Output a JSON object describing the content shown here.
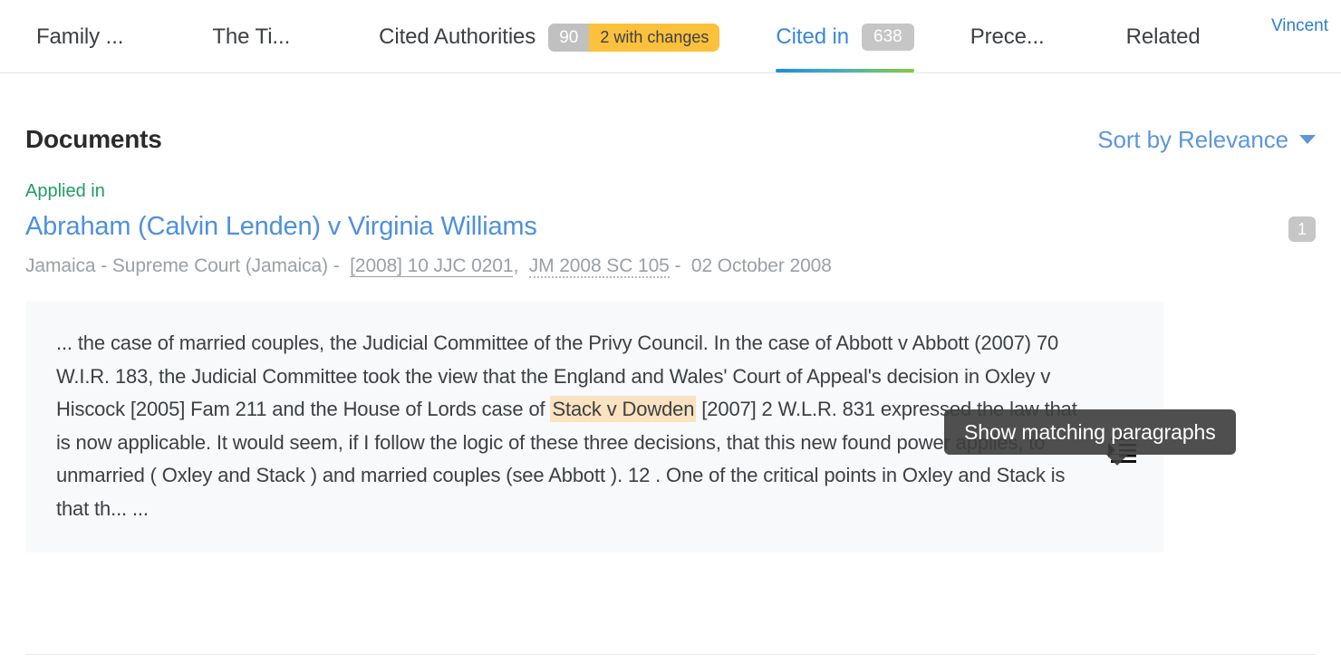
{
  "tabs": [
    {
      "label": "Family ...",
      "active": false,
      "badge": null
    },
    {
      "label": "The Ti...",
      "active": false,
      "badge": null
    },
    {
      "label": "Cited Authorities",
      "active": false,
      "badge_split": {
        "count": "90",
        "changes": "2 with changes"
      }
    },
    {
      "label": "Cited in",
      "active": true,
      "badge": "638"
    },
    {
      "label": "Prece...",
      "active": false,
      "badge": null
    },
    {
      "label": "Related",
      "active": false,
      "badge": null
    }
  ],
  "brand_mark": "Vincent",
  "header": {
    "title": "Documents",
    "sort_label": "Sort by Relevance",
    "sort_icon": "chevron-down-icon"
  },
  "result": {
    "relation": "Applied in",
    "case_title": "Abraham (Calvin Lenden) v Virginia Williams",
    "count_chip": "1",
    "meta": {
      "jurisdiction": "Jamaica - Supreme Court (Jamaica)",
      "dash1": "-",
      "citation_primary": "[2008] 10 JJC 0201",
      "comma": ",",
      "citation_secondary": "JM 2008 SC 105",
      "dash2": "-",
      "date": "02 October 2008"
    },
    "excerpt": {
      "before_highlight": "... the case of married couples, the Judicial Committee of the Privy Council. In the case of Abbott v Abbott (2007) 70 W.I.R. 183, the Judicial Committee took the view that the England and Wales' Court of Appeal's decision in Oxley v Hiscock [2005] Fam 211 and the House of Lords case of ",
      "highlight": "Stack v Dowden",
      "after_highlight": " [2007] 2 W.L.R. 831 expressed the law that is now applicable. It would seem, if I follow the logic of these three decisions, that this new found power applies, to unmarried ( Oxley and Stack ) and married couples (see Abbott ). 12 . One of the critical points in Oxley and Stack is that th... ..."
    },
    "match_icon": "show-matching-paragraphs-icon"
  },
  "tooltip": {
    "text": "Show matching paragraphs"
  },
  "colors": {
    "accent_blue": "#4d90e0",
    "relation_green": "#1e9e62",
    "badge_gray": "#c6c6c6",
    "badge_amber": "#fcc13c",
    "highlight": "#fbe2c0",
    "excerpt_bg": "#f8f9fb",
    "tooltip_bg": "#3e3e3e"
  }
}
